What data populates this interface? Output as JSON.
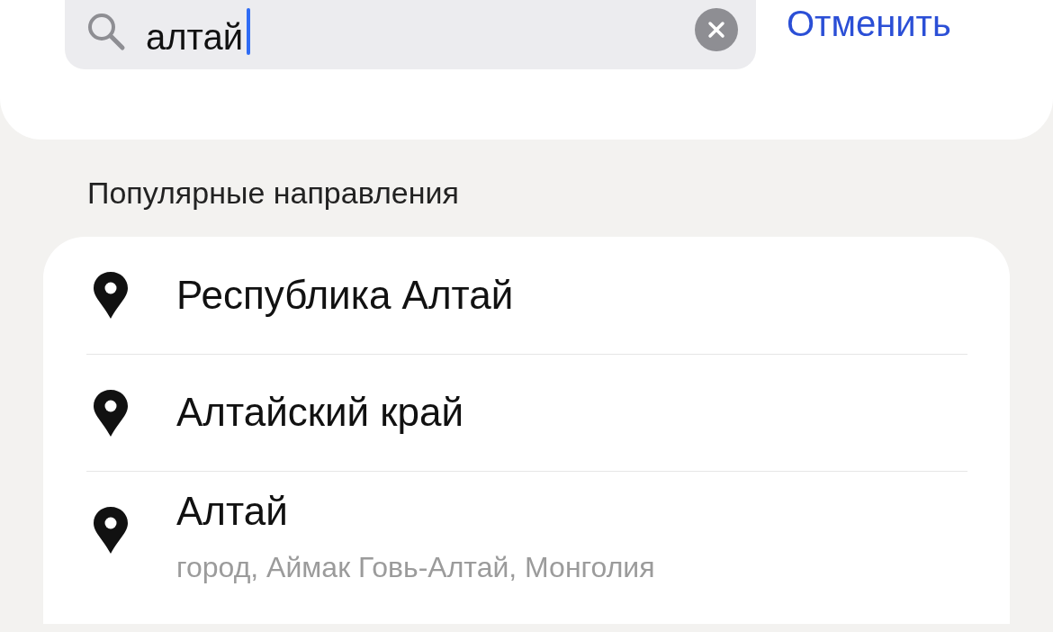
{
  "search": {
    "value": "алтай"
  },
  "cancel_button": "Отменить",
  "section_title": "Популярные направления",
  "destinations": [
    {
      "title": "Республика Алтай"
    },
    {
      "title": "Алтайский край"
    },
    {
      "title": "Алтай",
      "subtitle": "город, Аймак Говь-Алтай, Монголия"
    }
  ]
}
